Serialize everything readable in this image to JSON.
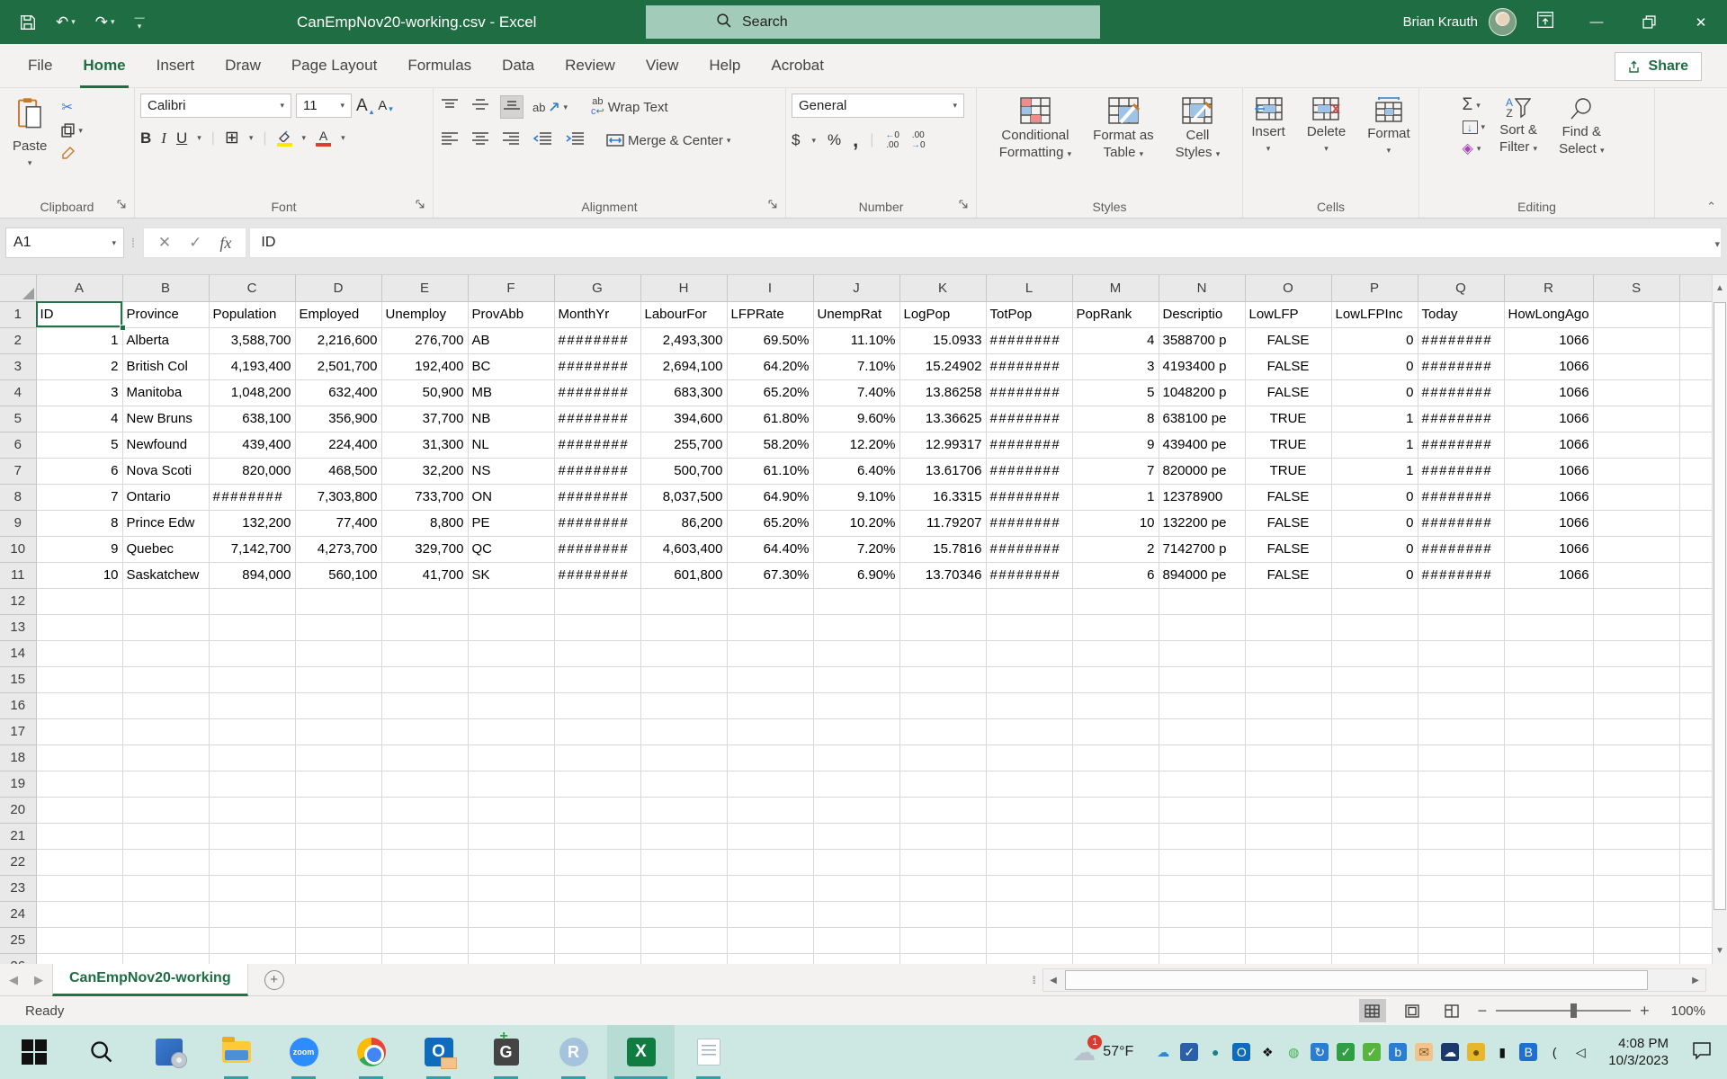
{
  "titlebar": {
    "title": "CanEmpNov20-working.csv  -  Excel",
    "search_placeholder": "Search",
    "user_name": "Brian Krauth"
  },
  "menu": {
    "tabs": [
      "File",
      "Home",
      "Insert",
      "Draw",
      "Page Layout",
      "Formulas",
      "Data",
      "Review",
      "View",
      "Help",
      "Acrobat"
    ],
    "selected_tab": "Home",
    "share_label": "Share"
  },
  "ribbon": {
    "clipboard": {
      "label": "Clipboard",
      "paste": "Paste"
    },
    "font": {
      "label": "Font",
      "font_name": "Calibri",
      "font_size": "11"
    },
    "alignment": {
      "label": "Alignment",
      "wrap_text": "Wrap Text",
      "merge_center": "Merge & Center"
    },
    "number": {
      "label": "Number",
      "format": "General"
    },
    "styles": {
      "label": "Styles",
      "conditional_line1": "Conditional",
      "conditional_line2": "Formatting",
      "format_table_line1": "Format as",
      "format_table_line2": "Table",
      "cell_styles_line1": "Cell",
      "cell_styles_line2": "Styles"
    },
    "cells": {
      "label": "Cells",
      "insert": "Insert",
      "delete": "Delete",
      "format": "Format"
    },
    "editing": {
      "label": "Editing",
      "sort_line1": "Sort &",
      "sort_line2": "Filter",
      "find_line1": "Find &",
      "find_line2": "Select"
    }
  },
  "formula_bar": {
    "name_box": "A1",
    "fx_label": "fx",
    "formula": "ID"
  },
  "sheet": {
    "selected_cell": "A1",
    "column_letters": [
      "A",
      "B",
      "C",
      "D",
      "E",
      "F",
      "G",
      "H",
      "I",
      "J",
      "K",
      "L",
      "M",
      "N",
      "O",
      "P",
      "Q",
      "R",
      "S"
    ],
    "header_row": [
      "ID",
      "Province",
      "Population",
      "Employed",
      "Unemploy",
      "ProvAbb",
      "MonthYr",
      "LabourFor",
      "LFPRate",
      "UnempRat",
      "LogPop",
      "TotPop",
      "PopRank",
      "Descriptio",
      "LowLFP",
      "LowLFPInc",
      "Today",
      "HowLongAgo",
      ""
    ],
    "rows": [
      [
        "1",
        "Alberta",
        "3,588,700",
        "2,216,600",
        "276,700",
        "AB",
        "########",
        "2,493,300",
        "69.50%",
        "11.10%",
        "15.0933",
        "########",
        "4",
        "3588700 p",
        "FALSE",
        "0",
        "########",
        "1066",
        ""
      ],
      [
        "2",
        "British Col",
        "4,193,400",
        "2,501,700",
        "192,400",
        "BC",
        "########",
        "2,694,100",
        "64.20%",
        "7.10%",
        "15.24902",
        "########",
        "3",
        "4193400 p",
        "FALSE",
        "0",
        "########",
        "1066",
        ""
      ],
      [
        "3",
        "Manitoba",
        "1,048,200",
        "632,400",
        "50,900",
        "MB",
        "########",
        "683,300",
        "65.20%",
        "7.40%",
        "13.86258",
        "########",
        "5",
        "1048200 p",
        "FALSE",
        "0",
        "########",
        "1066",
        ""
      ],
      [
        "4",
        "New Bruns",
        "638,100",
        "356,900",
        "37,700",
        "NB",
        "########",
        "394,600",
        "61.80%",
        "9.60%",
        "13.36625",
        "########",
        "8",
        "638100 pe",
        "TRUE",
        "1",
        "########",
        "1066",
        ""
      ],
      [
        "5",
        "Newfound",
        "439,400",
        "224,400",
        "31,300",
        "NL",
        "########",
        "255,700",
        "58.20%",
        "12.20%",
        "12.99317",
        "########",
        "9",
        "439400 pe",
        "TRUE",
        "1",
        "########",
        "1066",
        ""
      ],
      [
        "6",
        "Nova Scoti",
        "820,000",
        "468,500",
        "32,200",
        "NS",
        "########",
        "500,700",
        "61.10%",
        "6.40%",
        "13.61706",
        "########",
        "7",
        "820000 pe",
        "TRUE",
        "1",
        "########",
        "1066",
        ""
      ],
      [
        "7",
        "Ontario",
        "########",
        "7,303,800",
        "733,700",
        "ON",
        "########",
        "8,037,500",
        "64.90%",
        "9.10%",
        "16.3315",
        "########",
        "1",
        "12378900",
        "FALSE",
        "0",
        "########",
        "1066",
        ""
      ],
      [
        "8",
        "Prince Edw",
        "132,200",
        "77,400",
        "8,800",
        "PE",
        "########",
        "86,200",
        "65.20%",
        "10.20%",
        "11.79207",
        "########",
        "10",
        "132200 pe",
        "FALSE",
        "0",
        "########",
        "1066",
        ""
      ],
      [
        "9",
        "Quebec",
        "7,142,700",
        "4,273,700",
        "329,700",
        "QC",
        "########",
        "4,603,400",
        "64.40%",
        "7.20%",
        "15.7816",
        "########",
        "2",
        "7142700 p",
        "FALSE",
        "0",
        "########",
        "1066",
        ""
      ],
      [
        "10",
        "Saskatchew",
        "894,000",
        "560,100",
        "41,700",
        "SK",
        "########",
        "601,800",
        "67.30%",
        "6.90%",
        "13.70346",
        "########",
        "6",
        "894000 pe",
        "FALSE",
        "0",
        "########",
        "1066",
        ""
      ]
    ],
    "total_visible_rows": 26
  },
  "sheet_tabs": {
    "active_tab": "CanEmpNov20-working"
  },
  "status_bar": {
    "status": "Ready",
    "zoom_level": "100%"
  },
  "taskbar": {
    "weather_temp": "57°F",
    "weather_badge": "1",
    "clock_time": "4:08 PM",
    "clock_date": "10/3/2023",
    "apps": [
      {
        "name": "start-button",
        "kind": "start",
        "open": false,
        "active": false
      },
      {
        "name": "search-button",
        "kind": "search",
        "open": false,
        "active": false
      },
      {
        "name": "software-center",
        "kind": "software",
        "open": false,
        "active": false
      },
      {
        "name": "file-explorer",
        "kind": "explorer",
        "open": true,
        "active": false
      },
      {
        "name": "zoom-app",
        "kind": "zoom",
        "glyph": "zoom",
        "open": true,
        "active": false
      },
      {
        "name": "chrome",
        "kind": "chrome",
        "open": true,
        "active": false
      },
      {
        "name": "outlook",
        "kind": "outlook",
        "glyph": "O",
        "open": true,
        "active": false
      },
      {
        "name": "git-app",
        "kind": "git",
        "glyph": "G",
        "open": true,
        "active": false
      },
      {
        "name": "r-app",
        "kind": "r",
        "glyph": "R",
        "open": true,
        "active": false
      },
      {
        "name": "excel",
        "kind": "excel",
        "glyph": "X",
        "open": true,
        "active": true
      },
      {
        "name": "notepad",
        "kind": "notepad",
        "open": true,
        "active": false
      }
    ],
    "tray_icons": [
      {
        "name": "onedrive-icon",
        "glyph": "☁",
        "color": "#2b88d8",
        "bg": "transparent"
      },
      {
        "name": "security-shield-icon",
        "glyph": "✓",
        "color": "#fff",
        "bg": "#2b5fa8"
      },
      {
        "name": "location-pin-icon",
        "glyph": "●",
        "color": "#1b7f8c",
        "bg": "transparent"
      },
      {
        "name": "outlook-tray-icon",
        "glyph": "O",
        "color": "#fff",
        "bg": "#0f6cbd"
      },
      {
        "name": "dropbox-icon",
        "glyph": "❖",
        "color": "#111",
        "bg": "transparent"
      },
      {
        "name": "globe-icon",
        "glyph": "◍",
        "color": "#3fae49",
        "bg": "transparent"
      },
      {
        "name": "cloud-sync-icon",
        "glyph": "↻",
        "color": "#fff",
        "bg": "#2b7cd3"
      },
      {
        "name": "defender-icon",
        "glyph": "✓",
        "color": "#fff",
        "bg": "#2f9e44"
      },
      {
        "name": "update-ok-icon",
        "glyph": "✓",
        "color": "#fff",
        "bg": "#58b53c"
      },
      {
        "name": "bing-icon",
        "glyph": "b",
        "color": "#fff",
        "bg": "#2b7cd3"
      },
      {
        "name": "mail-icon",
        "glyph": "✉",
        "color": "#8a5a19",
        "bg": "#f0c48c"
      },
      {
        "name": "vpn-cloud-icon",
        "glyph": "☁",
        "color": "#fff",
        "bg": "#1b3a6b"
      },
      {
        "name": "hotspot-lock-icon",
        "glyph": "●",
        "color": "#6b5200",
        "bg": "#e8b62a"
      },
      {
        "name": "battery-icon",
        "glyph": "▮",
        "color": "#111",
        "bg": "transparent"
      },
      {
        "name": "bluetooth-icon",
        "glyph": "B",
        "color": "#fff",
        "bg": "#1f6fd0"
      },
      {
        "name": "wifi-icon",
        "glyph": "(",
        "color": "#111",
        "bg": "transparent"
      },
      {
        "name": "volume-icon",
        "glyph": "◁",
        "color": "#111",
        "bg": "transparent"
      }
    ]
  },
  "colors": {
    "excel_green": "#217346",
    "title_bar": "#1f6e43",
    "search_box": "#a3cbba",
    "ribbon_bg": "#f3f2f1",
    "taskbar_bg": "#cde8e2",
    "taskbar_accent": "#2ea3a6",
    "gridline": "#d8d8d8",
    "fill_yellow": "#ffe600",
    "font_red": "#e03c31"
  }
}
